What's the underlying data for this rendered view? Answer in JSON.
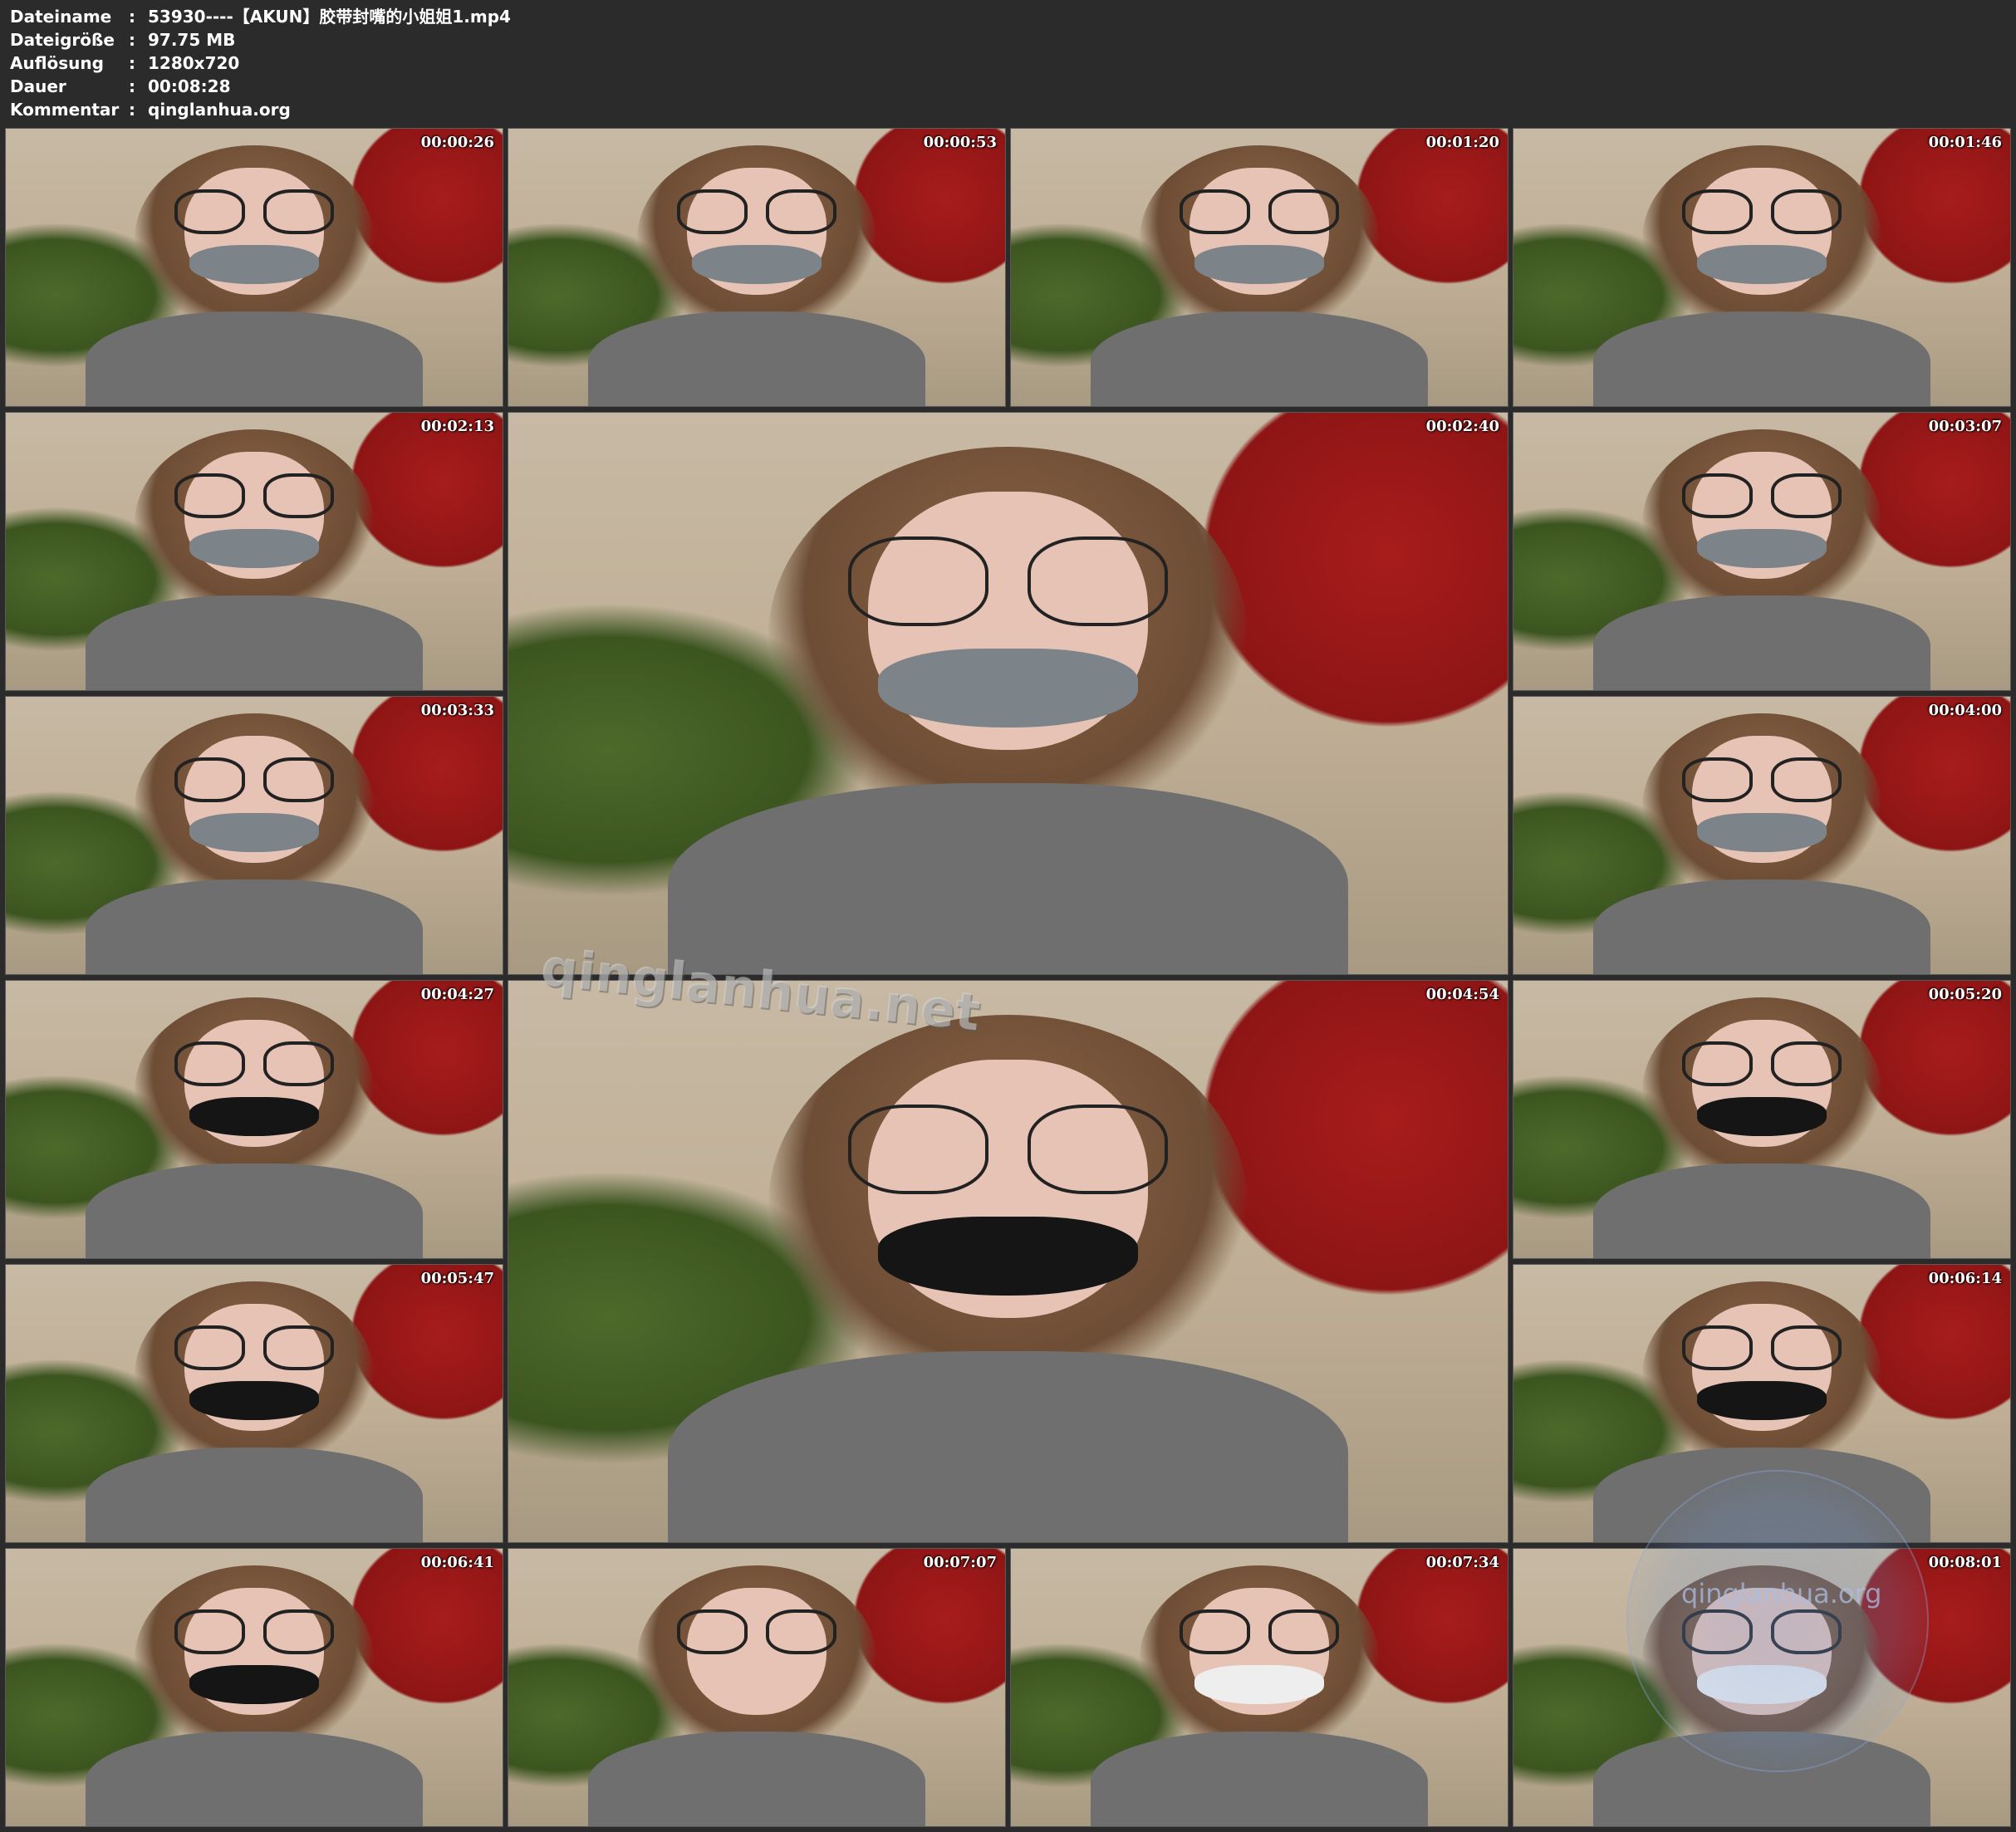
{
  "header": {
    "rows": [
      {
        "key": "Dateiname",
        "sep": ":",
        "value": "53930----【AKUN】胶带封嘴的小姐姐1.mp4"
      },
      {
        "key": "Dateigröße",
        "sep": ":",
        "value": "97.75 MB"
      },
      {
        "key": "Auflösung",
        "sep": ":",
        "value": "1280x720"
      },
      {
        "key": "Dauer",
        "sep": ":",
        "value": "00:08:28"
      },
      {
        "key": "Kommentar",
        "sep": ":",
        "value": "qinglanhua.org"
      }
    ]
  },
  "thumbnails": [
    {
      "timestamp": "00:00:26",
      "gag": "grey-tape"
    },
    {
      "timestamp": "00:00:53",
      "gag": "grey-tape"
    },
    {
      "timestamp": "00:01:20",
      "gag": "grey-tape"
    },
    {
      "timestamp": "00:01:46",
      "gag": "grey-tape"
    },
    {
      "timestamp": "00:02:13",
      "gag": "grey-tape"
    },
    {
      "timestamp": "00:02:40",
      "gag": "grey-tape"
    },
    {
      "timestamp": "00:03:07",
      "gag": "grey-tape"
    },
    {
      "timestamp": "00:03:33",
      "gag": "grey-tape"
    },
    {
      "timestamp": "00:04:00",
      "gag": "grey-tape"
    },
    {
      "timestamp": "00:04:27",
      "gag": "black-cloth"
    },
    {
      "timestamp": "00:04:54",
      "gag": "black-cloth"
    },
    {
      "timestamp": "00:05:20",
      "gag": "black-cloth"
    },
    {
      "timestamp": "00:05:47",
      "gag": "black-cloth"
    },
    {
      "timestamp": "00:06:14",
      "gag": "black-cloth"
    },
    {
      "timestamp": "00:06:41",
      "gag": "black-cloth"
    },
    {
      "timestamp": "00:07:07",
      "gag": "none"
    },
    {
      "timestamp": "00:07:34",
      "gag": "white-tape"
    },
    {
      "timestamp": "00:08:01",
      "gag": "white-tape"
    }
  ],
  "watermarks": {
    "main": "qinglanhua.net",
    "corner": "qinglanhua.org"
  },
  "colors": {
    "background": "#2b2b2b",
    "text": "#ffffff",
    "grey_tape": "#7d8489",
    "black_cloth": "#151515",
    "white_tape": "#eeeeee"
  }
}
